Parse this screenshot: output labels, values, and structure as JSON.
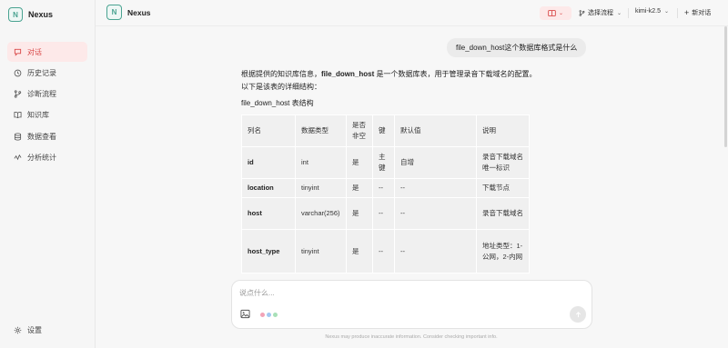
{
  "brand": {
    "logo_letter": "N",
    "name": "Nexus"
  },
  "sidebar": {
    "items": [
      {
        "label": "对话",
        "icon": "chat-icon",
        "active": true
      },
      {
        "label": "历史记录",
        "icon": "history-icon",
        "active": false
      },
      {
        "label": "诊断流程",
        "icon": "flow-icon",
        "active": false
      },
      {
        "label": "知识库",
        "icon": "book-icon",
        "active": false
      },
      {
        "label": "数据查看",
        "icon": "database-icon",
        "active": false
      },
      {
        "label": "分析统计",
        "icon": "chart-icon",
        "active": false
      }
    ],
    "settings_label": "设置"
  },
  "topbar": {
    "logo_letter": "N",
    "title": "Nexus",
    "select_flow_label": "选择流程",
    "model_label": "kimi-k2.5",
    "new_chat_label": "新对话"
  },
  "chat": {
    "user_message": "file_down_host这个数据库格式是什么",
    "answer": {
      "intro_prefix": "根据提供的知识库信息，",
      "intro_bold": "file_down_host",
      "intro_suffix": " 是一个数据库表，用于管理录音下载域名的配置。",
      "intro_line2": "以下是该表的详细结构：",
      "table_title": "file_down_host 表结构",
      "table_headers": [
        "列名",
        "数据类型",
        "是否非空",
        "键",
        "默认值",
        "说明"
      ],
      "table_rows": [
        [
          "id",
          "int",
          "是",
          "主键",
          "自增",
          "录音下载域名唯一标识"
        ],
        [
          "location",
          "tinyint",
          "是",
          "--",
          "--",
          "下载节点"
        ],
        [
          "host",
          "varchar(256)",
          "是",
          "--",
          "--",
          "录音下载域名"
        ],
        [
          "host_type",
          "tinyint",
          "是",
          "--",
          "--",
          "地址类型：1-公网，2-内网"
        ]
      ]
    }
  },
  "input": {
    "placeholder": "说点什么...",
    "disclaimer": "Nexus may produce inaccurate information. Consider checking important info."
  },
  "colors": {
    "accent": "#d94848",
    "accent_bg": "#fde9e9",
    "brand": "#4aa391"
  }
}
